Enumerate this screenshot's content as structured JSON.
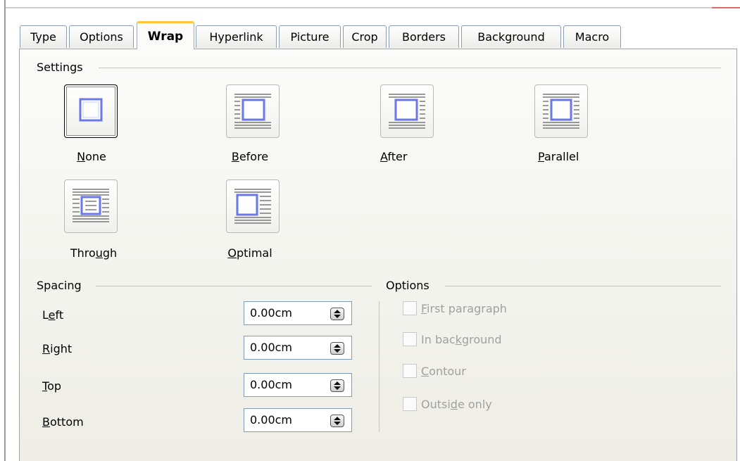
{
  "tabs": [
    {
      "label": "Type"
    },
    {
      "label": "Options"
    },
    {
      "label": "Wrap",
      "active": true
    },
    {
      "label": "Hyperlink"
    },
    {
      "label": "Picture"
    },
    {
      "label": "Crop"
    },
    {
      "label": "Borders"
    },
    {
      "label": "Background"
    },
    {
      "label": "Macro"
    }
  ],
  "settings": {
    "label": "Settings",
    "options": [
      {
        "pre": "",
        "u": "N",
        "post": "one",
        "icon": "wrap-none-icon",
        "selected": true
      },
      {
        "pre": "",
        "u": "B",
        "post": "efore",
        "icon": "wrap-before-icon"
      },
      {
        "pre": "",
        "u": "A",
        "post": "fter",
        "icon": "wrap-after-icon"
      },
      {
        "pre": "",
        "u": "P",
        "post": "arallel",
        "icon": "wrap-parallel-icon"
      },
      {
        "pre": "Thro",
        "u": "u",
        "post": "gh",
        "icon": "wrap-through-icon"
      },
      {
        "pre": "",
        "u": "O",
        "post": "ptimal",
        "icon": "wrap-optimal-icon"
      }
    ]
  },
  "spacing": {
    "label": "Spacing",
    "fields": [
      {
        "pre": "L",
        "u": "e",
        "post": "ft",
        "value": "0.00cm"
      },
      {
        "pre": "",
        "u": "R",
        "post": "ight",
        "value": "0.00cm"
      },
      {
        "pre": "",
        "u": "T",
        "post": "op",
        "value": "0.00cm"
      },
      {
        "pre": "",
        "u": "B",
        "post": "ottom",
        "value": "0.00cm"
      }
    ]
  },
  "options": {
    "label": "Options",
    "items": [
      {
        "pre": "",
        "u": "F",
        "post": "irst paragraph",
        "checked": false,
        "enabled": false
      },
      {
        "pre": "In bac",
        "u": "k",
        "post": "ground",
        "checked": false,
        "enabled": false
      },
      {
        "pre": "",
        "u": "C",
        "post": "ontour",
        "checked": false,
        "enabled": false
      },
      {
        "pre": "Outsi",
        "u": "d",
        "post": "e only",
        "checked": false,
        "enabled": false
      }
    ]
  },
  "colors": {
    "accent": "#ffc43a",
    "frame": "#6b78e8",
    "line": "#7a7a7a"
  }
}
